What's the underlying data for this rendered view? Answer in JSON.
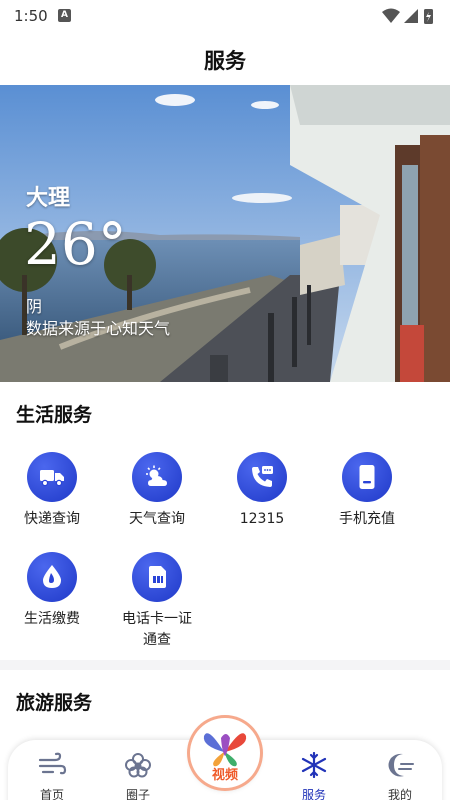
{
  "status_bar": {
    "time": "1:50",
    "notification_letter": "A"
  },
  "header": {
    "title": "服务"
  },
  "weather": {
    "city": "大理",
    "temperature": "26°",
    "condition": "阴",
    "source": "数据来源于心知天气"
  },
  "life_services": {
    "title": "生活服务",
    "items": [
      {
        "label": "快递查询",
        "icon": "truck-icon"
      },
      {
        "label": "天气查询",
        "icon": "weather-icon"
      },
      {
        "label": "12315",
        "icon": "phone-message-icon"
      },
      {
        "label": "手机充值",
        "icon": "mobile-recharge-icon"
      },
      {
        "label": "生活缴费",
        "icon": "water-drop-icon"
      },
      {
        "label": "电话卡一证通查",
        "icon": "sim-card-icon"
      }
    ]
  },
  "travel_services": {
    "title": "旅游服务"
  },
  "tabbar": {
    "items": [
      {
        "label": "首页",
        "icon": "wind-icon"
      },
      {
        "label": "圈子",
        "icon": "flower-icon"
      },
      {
        "label": "服务",
        "icon": "snowflake-icon",
        "active": true
      },
      {
        "label": "我的",
        "icon": "moon-icon"
      }
    ],
    "video_label": "视频"
  },
  "colors": {
    "accent": "#2133b8",
    "icon_blue": "#2a44d6",
    "video_orange": "#ef5b2a"
  }
}
